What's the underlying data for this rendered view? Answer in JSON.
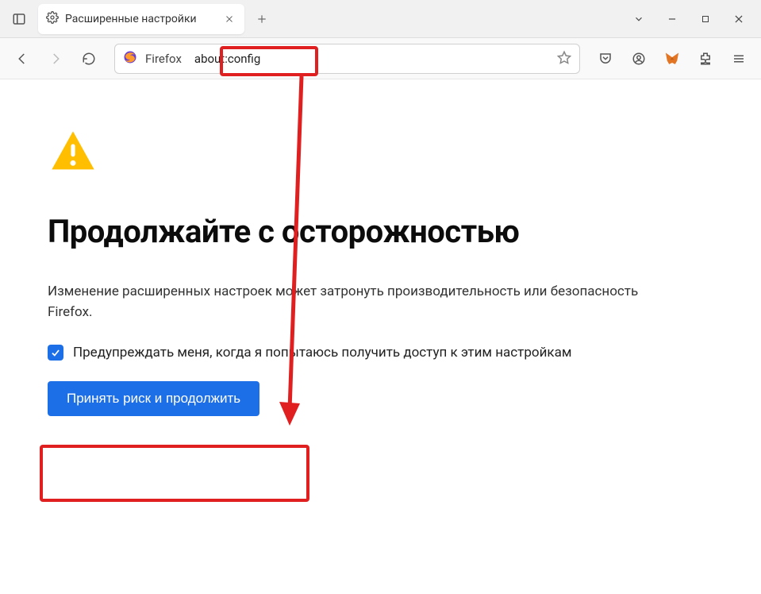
{
  "tab": {
    "title": "Расширенные настройки"
  },
  "urlbar": {
    "fx_label": "Firefox",
    "url": "about:config"
  },
  "page": {
    "heading": "Продолжайте с осторожностью",
    "description": "Изменение расширенных настроек может затронуть производительность или безопасность Firefox.",
    "checkbox_label": "Предупреждать меня, когда я попытаюсь получить доступ к этим настройкам",
    "accept_label": "Принять риск и продолжить"
  }
}
